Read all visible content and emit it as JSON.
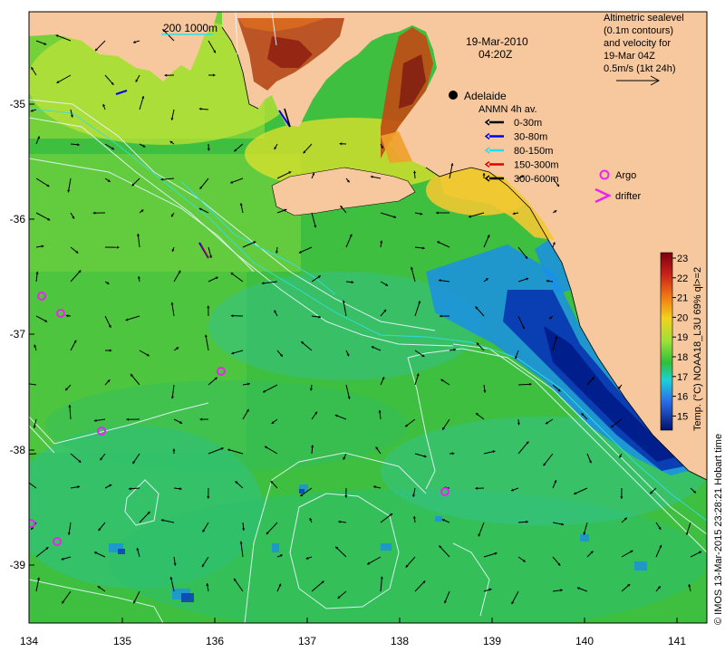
{
  "map": {
    "date": "19-Mar-2010",
    "time": "04:20Z",
    "city": "Adelaide",
    "scale_label": "200  1000m",
    "info_lines": [
      "Altimetric sealevel",
      "(0.1m contours)",
      "and velocity for",
      "19-Mar 04Z",
      "0.5m/s (1kt 24h)"
    ],
    "legend": {
      "title": "ANMN 4h av.",
      "items": [
        {
          "label": "0-30m",
          "color": "#000000"
        },
        {
          "label": "30-80m",
          "color": "#0000ee"
        },
        {
          "label": "80-150m",
          "color": "#22ddee"
        },
        {
          "label": "150-300m",
          "color": "#dd0000"
        },
        {
          "label": "300-600m",
          "color": "#000000"
        }
      ],
      "argo_label": "Argo",
      "drifter_label": "drifter",
      "argo_color": "#ee22ee"
    },
    "colorbar": {
      "ticks": [
        "23",
        "22",
        "21",
        "20",
        "19",
        "18",
        "17",
        "16",
        "15"
      ],
      "label": "Temp. (°C) NOAA18_L3U 69% ql>=2"
    },
    "credit": "© IMOS 13-Mar-2015 23:28:21 Hobart time",
    "x_ticks": [
      "134",
      "135",
      "136",
      "137",
      "138",
      "139",
      "140",
      "141"
    ],
    "y_ticks": [
      "-35",
      "-36",
      "-37",
      "-38",
      "-39"
    ],
    "colors": {
      "land": "#f7c89e",
      "sea_green": "#3fbf3f",
      "cold_blue": "#001e8c",
      "argo": "#ee22ee"
    }
  }
}
